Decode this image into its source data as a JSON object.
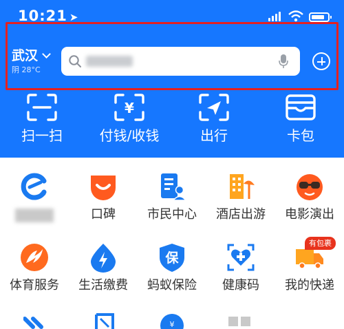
{
  "status": {
    "time": "10:21"
  },
  "header": {
    "city": "武汉",
    "weather": "阴 28°C",
    "search_placeholder": ""
  },
  "actions": [
    {
      "label": "扫一扫",
      "icon": "scan-icon"
    },
    {
      "label": "付钱/收钱",
      "icon": "pay-icon"
    },
    {
      "label": "出行",
      "icon": "travel-icon"
    },
    {
      "label": "卡包",
      "icon": "card-wallet-icon"
    }
  ],
  "grid": [
    {
      "label": "",
      "icon": "eleme-icon",
      "color": "#1a7af0"
    },
    {
      "label": "口碑",
      "icon": "koubei-icon",
      "color": "#ff5a1f"
    },
    {
      "label": "市民中心",
      "icon": "citizen-center-icon",
      "color": "#1a7af0"
    },
    {
      "label": "酒店出游",
      "icon": "hotel-travel-icon",
      "color": "#ff9a1f"
    },
    {
      "label": "电影演出",
      "icon": "movie-icon",
      "color": "#ff5a1f"
    },
    {
      "label": "体育服务",
      "icon": "sports-icon",
      "color": "#ff6a1f"
    },
    {
      "label": "生活缴费",
      "icon": "utility-payment-icon",
      "color": "#1a7af0"
    },
    {
      "label": "蚂蚁保险",
      "icon": "ant-insurance-icon",
      "color": "#1a7af0"
    },
    {
      "label": "健康码",
      "icon": "health-code-icon",
      "color": "#1a7af0"
    },
    {
      "label": "我的快递",
      "icon": "express-delivery-icon",
      "color": "#ff9a1f"
    }
  ],
  "badge": "有包裹",
  "colors": {
    "header_bg": "#1677ff",
    "highlight": "#e52020",
    "badge_bg": "#e8331d"
  }
}
